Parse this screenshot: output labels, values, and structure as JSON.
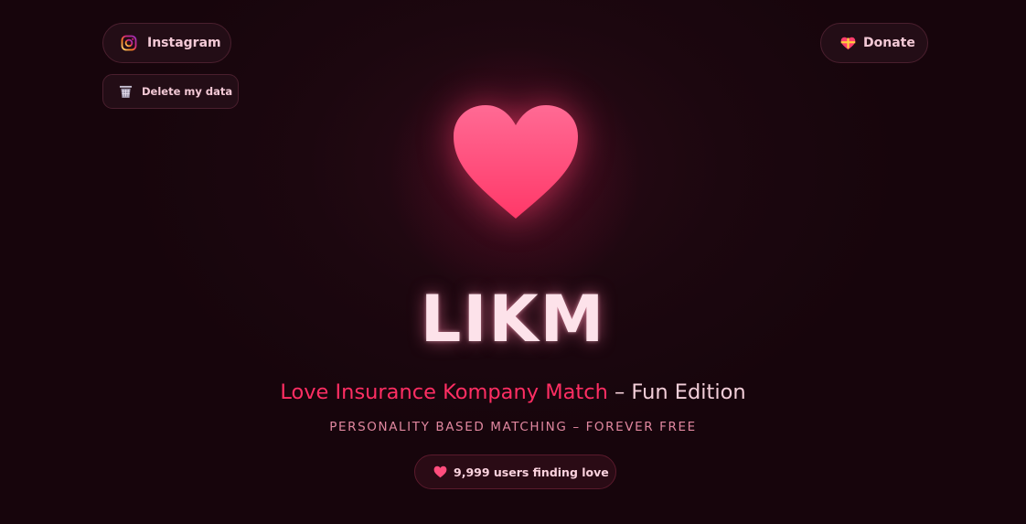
{
  "header": {
    "instagram_label": "Instagram",
    "delete_label": "Delete my data",
    "donate_label": "Donate"
  },
  "hero": {
    "brand": "LIKM",
    "tagline_accent": "Love Insurance Kompany Match",
    "tagline_rest": " – Fun Edition",
    "subtitle": "PERSONALITY BASED MATCHING – FOREVER FREE",
    "users_badge": "9,999 users finding love"
  },
  "colors": {
    "background": "#1c070f",
    "accent": "#ff2e63",
    "heart": "#ff4d7d",
    "brand_text": "#fde2ea",
    "subtitle": "#e0879f"
  },
  "icons": {
    "instagram": "instagram-icon",
    "delete": "trash-icon",
    "donate": "heart-gift-icon",
    "hero": "heart-icon",
    "badge": "heart-icon"
  }
}
